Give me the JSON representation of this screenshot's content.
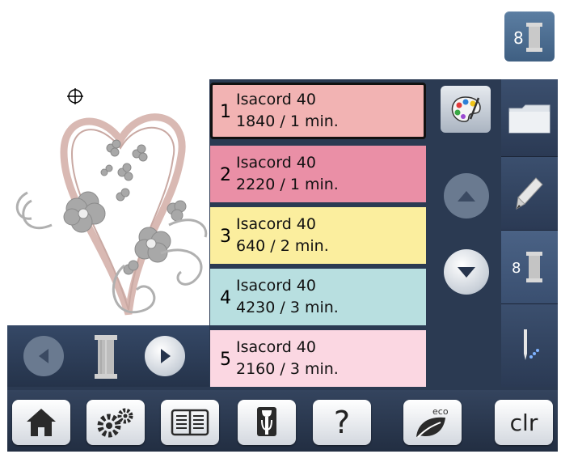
{
  "threads": [
    {
      "number": "1",
      "name": "Isacord 40",
      "info": "1840 / 1 min.",
      "color": "#f2b3b3",
      "selected": true
    },
    {
      "number": "2",
      "name": "Isacord 40",
      "info": "2220 / 1 min.",
      "color": "#ea8fa6",
      "selected": false
    },
    {
      "number": "3",
      "name": "Isacord 40",
      "info": "640 / 2 min.",
      "color": "#fbee9e",
      "selected": false
    },
    {
      "number": "4",
      "name": "Isacord 40",
      "info": "4230 / 3 min.",
      "color": "#b8dfe0",
      "selected": false
    },
    {
      "number": "5",
      "name": "Isacord 40",
      "info": "2160 / 3 min.",
      "color": "#fbd7e2",
      "selected": false
    }
  ],
  "spool_count": "8",
  "tab_spool_count": "8",
  "toolbar": {
    "help_label": "?",
    "eco_label": "eco",
    "clr_label": "clr"
  },
  "icons": {
    "corner": "thread-spool-icon",
    "palette": "color-palette-icon",
    "folder": "folder-icon",
    "pencil": "pencil-icon",
    "needle": "needle-icon",
    "home": "home-icon",
    "settings": "gears-icon",
    "tutorial": "book-icon",
    "dressform": "dress-form-icon"
  }
}
